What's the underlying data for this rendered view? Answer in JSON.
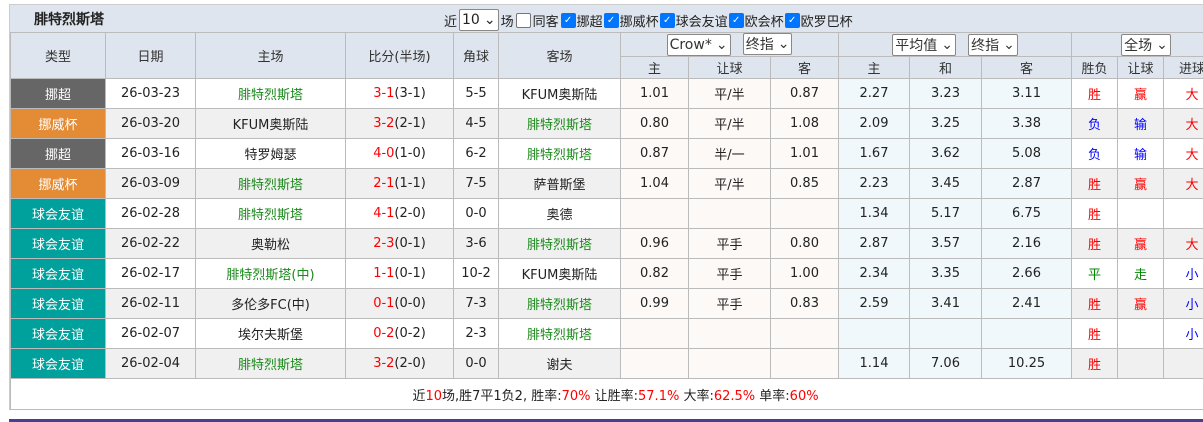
{
  "title": "腓特烈斯塔",
  "filters": {
    "recent_label": "近",
    "recent_value": "10",
    "unit": "场",
    "same_home_label": "同客",
    "same_home_checked": false,
    "leagues": [
      {
        "label": "挪超",
        "checked": true
      },
      {
        "label": "挪威杯",
        "checked": true
      },
      {
        "label": "球会友谊",
        "checked": true
      },
      {
        "label": "欧会杯",
        "checked": true
      },
      {
        "label": "欧罗巴杯",
        "checked": true
      }
    ]
  },
  "headers": {
    "type": "类型",
    "date": "日期",
    "home": "主场",
    "score": "比分(半场)",
    "corner": "角球",
    "away": "客场",
    "company_select": "Crow*",
    "odds_select1": "终指",
    "avg_select": "平均值",
    "odds_select2": "终指",
    "period_select": "全场",
    "ah_home": "主",
    "ah_line": "让球",
    "ah_away": "客",
    "eu_home": "主",
    "eu_draw": "和",
    "eu_away": "客",
    "res": "胜负",
    "ah_res": "让球",
    "ou_res": "进球"
  },
  "type_colors": {
    "挪超": "#666666",
    "挪威杯": "#e38b35",
    "球会友谊": "#00a19c"
  },
  "rows": [
    {
      "type": "挪超",
      "date": "26-03-23",
      "home": "腓特烈斯塔",
      "home_team": true,
      "ft": "3-1",
      "ht": "(3-1)",
      "corner": "5-5",
      "away": "KFUM奥斯陆",
      "away_team": false,
      "ah_h": "1.01",
      "ah": "平/半",
      "ah_a": "0.87",
      "eu_h": "2.27",
      "eu_d": "3.23",
      "eu_a": "3.11",
      "res": "胜",
      "ah_res": "赢",
      "ou": "大"
    },
    {
      "type": "挪威杯",
      "date": "26-03-20",
      "home": "KFUM奥斯陆",
      "home_team": false,
      "ft": "3-2",
      "ht": "(2-1)",
      "corner": "4-5",
      "away": "腓特烈斯塔",
      "away_team": true,
      "ah_h": "0.80",
      "ah": "平/半",
      "ah_a": "1.08",
      "eu_h": "2.09",
      "eu_d": "3.25",
      "eu_a": "3.38",
      "res": "负",
      "ah_res": "输",
      "ou": "大"
    },
    {
      "type": "挪超",
      "date": "26-03-16",
      "home": "特罗姆瑟",
      "home_team": false,
      "ft": "4-0",
      "ht": "(1-0)",
      "corner": "6-2",
      "away": "腓特烈斯塔",
      "away_team": true,
      "ah_h": "0.87",
      "ah": "半/一",
      "ah_a": "1.01",
      "eu_h": "1.67",
      "eu_d": "3.62",
      "eu_a": "5.08",
      "res": "负",
      "ah_res": "输",
      "ou": "大"
    },
    {
      "type": "挪威杯",
      "date": "26-03-09",
      "home": "腓特烈斯塔",
      "home_team": true,
      "ft": "2-1",
      "ht": "(1-1)",
      "corner": "7-5",
      "away": "萨普斯堡",
      "away_team": false,
      "ah_h": "1.04",
      "ah": "平/半",
      "ah_a": "0.85",
      "eu_h": "2.23",
      "eu_d": "3.45",
      "eu_a": "2.87",
      "res": "胜",
      "ah_res": "赢",
      "ou": "大"
    },
    {
      "type": "球会友谊",
      "date": "26-02-28",
      "home": "腓特烈斯塔",
      "home_team": true,
      "ft": "4-1",
      "ht": "(2-0)",
      "corner": "0-0",
      "away": "奥德",
      "away_team": false,
      "ah_h": "",
      "ah": "",
      "ah_a": "",
      "eu_h": "1.34",
      "eu_d": "5.17",
      "eu_a": "6.75",
      "res": "胜",
      "ah_res": "",
      "ou": ""
    },
    {
      "type": "球会友谊",
      "date": "26-02-22",
      "home": "奥勒松",
      "home_team": false,
      "ft": "2-3",
      "ht": "(0-1)",
      "corner": "3-6",
      "away": "腓特烈斯塔",
      "away_team": true,
      "ah_h": "0.96",
      "ah": "平手",
      "ah_a": "0.80",
      "eu_h": "2.87",
      "eu_d": "3.57",
      "eu_a": "2.16",
      "res": "胜",
      "ah_res": "赢",
      "ou": "大"
    },
    {
      "type": "球会友谊",
      "date": "26-02-17",
      "home": "腓特烈斯塔(中)",
      "home_team": true,
      "ft": "1-1",
      "ht": "(0-1)",
      "corner": "10-2",
      "away": "KFUM奥斯陆",
      "away_team": false,
      "ah_h": "0.82",
      "ah": "平手",
      "ah_a": "1.00",
      "eu_h": "2.34",
      "eu_d": "3.35",
      "eu_a": "2.66",
      "res": "平",
      "ah_res": "走",
      "ou": "小"
    },
    {
      "type": "球会友谊",
      "date": "26-02-11",
      "home": "多伦多FC(中)",
      "home_team": false,
      "ft": "0-1",
      "ht": "(0-0)",
      "corner": "7-3",
      "away": "腓特烈斯塔",
      "away_team": true,
      "ah_h": "0.99",
      "ah": "平手",
      "ah_a": "0.83",
      "eu_h": "2.59",
      "eu_d": "3.41",
      "eu_a": "2.41",
      "res": "胜",
      "ah_res": "赢",
      "ou": "小"
    },
    {
      "type": "球会友谊",
      "date": "26-02-07",
      "home": "埃尔夫斯堡",
      "home_team": false,
      "ft": "0-2",
      "ht": "(0-2)",
      "corner": "2-3",
      "away": "腓特烈斯塔",
      "away_team": true,
      "ah_h": "",
      "ah": "",
      "ah_a": "",
      "eu_h": "",
      "eu_d": "",
      "eu_a": "",
      "res": "胜",
      "ah_res": "",
      "ou": "小"
    },
    {
      "type": "球会友谊",
      "date": "26-02-04",
      "home": "腓特烈斯塔",
      "home_team": true,
      "ft": "3-2",
      "ht": "(2-0)",
      "corner": "0-0",
      "away": "谢夫",
      "away_team": false,
      "ah_h": "",
      "ah": "",
      "ah_a": "",
      "eu_h": "1.14",
      "eu_d": "7.06",
      "eu_a": "10.25",
      "res": "胜",
      "ah_res": "",
      "ou": ""
    }
  ],
  "summary": {
    "p1": "近",
    "n": "10",
    "p2": "场,胜7平1负2, 胜率:",
    "win_rate": "70%",
    "p3": " 让胜率:",
    "ah_rate": "57.1%",
    "p4": " 大率:",
    "over_rate": "62.5%",
    "p5": " 单率:",
    "odd_rate": "60%"
  }
}
